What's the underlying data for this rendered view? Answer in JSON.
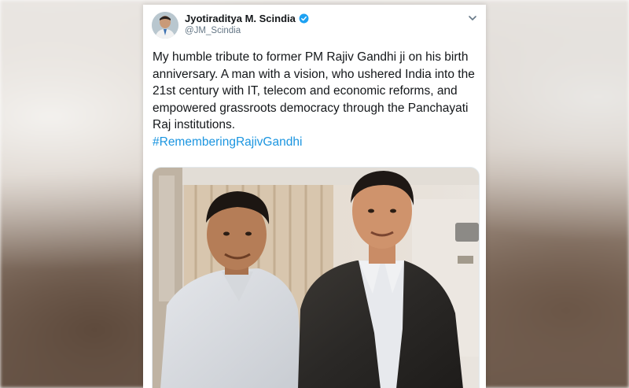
{
  "tweet": {
    "author": {
      "display_name": "Jyotiraditya M. Scindia",
      "handle": "@JM_Scindia",
      "verified": true,
      "avatar_icon": "profile-avatar"
    },
    "text": "My humble tribute to former PM Rajiv Gandhi ji on his birth anniversary. A man with a vision, who ushered India into the 21st century with IT, telecom and economic reforms, and empowered grassroots democracy through the Panchayati Raj institutions.",
    "hashtag": "#RememberingRajivGandhi",
    "menu_icon": "chevron-down-icon",
    "media": {
      "type": "photo",
      "description_icon": "photo-two-men"
    }
  },
  "colors": {
    "link": "#1b95e0",
    "verified": "#1da1f2",
    "text": "#14171a",
    "muted": "#657786"
  }
}
